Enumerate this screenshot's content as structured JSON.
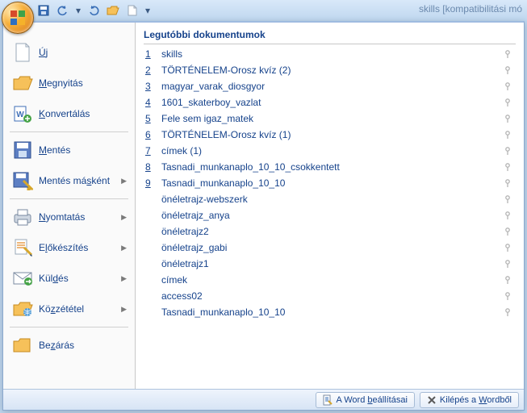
{
  "title": "skills [kompatibilitási mó",
  "menu": {
    "new": "Új",
    "open": "Megnyitás",
    "convert": "Konvertálás",
    "save": "Mentés",
    "saveas": "Mentés másként",
    "print": "Nyomtatás",
    "prepare": "Előkészítés",
    "send": "Küldés",
    "publish": "Közzététel",
    "close": "Bezárás"
  },
  "recent_header": "Legutóbbi dokumentumok",
  "recent": [
    {
      "n": "1",
      "label": "skills"
    },
    {
      "n": "2",
      "label": "TÖRTÉNELEM-Orosz kvíz (2)"
    },
    {
      "n": "3",
      "label": "magyar_varak_diosgyor"
    },
    {
      "n": "4",
      "label": "1601_skaterboy_vazlat"
    },
    {
      "n": "5",
      "label": "Fele sem igaz_matek"
    },
    {
      "n": "6",
      "label": "TÖRTÉNELEM-Orosz kvíz (1)"
    },
    {
      "n": "7",
      "label": "címek (1)"
    },
    {
      "n": "8",
      "label": "Tasnadi_munkanaplo_10_10_csokkentett"
    },
    {
      "n": "9",
      "label": "Tasnadi_munkanaplo_10_10"
    },
    {
      "n": "",
      "label": "önéletrajz-webszerk"
    },
    {
      "n": "",
      "label": "önéletrajz_anya"
    },
    {
      "n": "",
      "label": "önéletrajz2"
    },
    {
      "n": "",
      "label": "önéletrajz_gabi"
    },
    {
      "n": "",
      "label": "önéletrajz1"
    },
    {
      "n": "",
      "label": "címek"
    },
    {
      "n": "",
      "label": "access02"
    },
    {
      "n": "",
      "label": "Tasnadi_munkanaplo_10_10"
    }
  ],
  "bottom": {
    "options": "A Word beállításai",
    "exit": "Kilépés a Wordből"
  }
}
